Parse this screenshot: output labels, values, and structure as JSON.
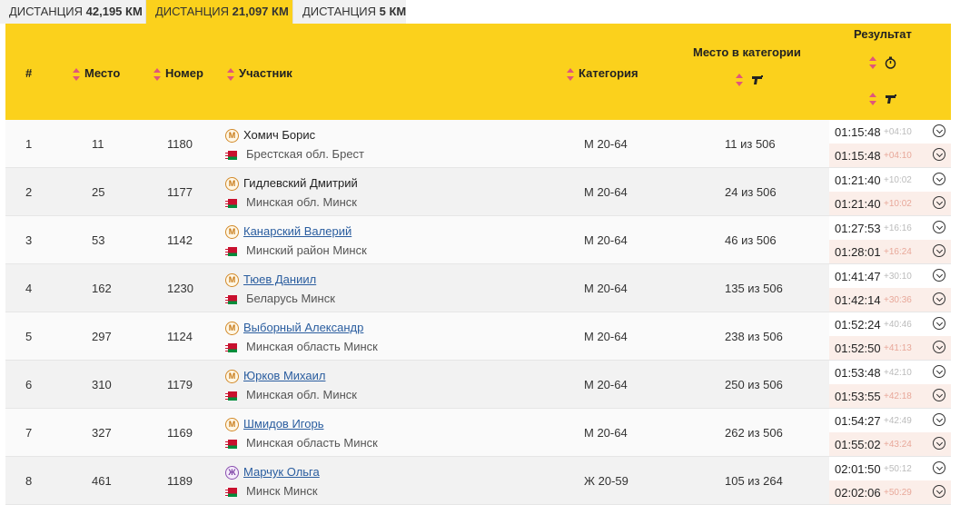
{
  "tabs": [
    {
      "prefix": "ДИСТАНЦИЯ ",
      "value": "42,195 КМ",
      "active": false
    },
    {
      "prefix": "ДИСТАНЦИЯ ",
      "value": "21,097 КМ",
      "active": true
    },
    {
      "prefix": "ДИСТАНЦИЯ ",
      "value": "5 КМ",
      "active": false
    }
  ],
  "header": {
    "index": "#",
    "place": "Место",
    "number": "Номер",
    "participant": "Участник",
    "category": "Категория",
    "place_in_category": "Место в категории",
    "result": "Результат"
  },
  "rows": [
    {
      "index": "1",
      "place": "11",
      "number": "1180",
      "gender": "М",
      "name": "Хомич Борис",
      "linked": false,
      "location": "Брестская обл. Брест",
      "category": "М 20-64",
      "cat_place": "11 из 506",
      "time1": "01:15:48",
      "gap1": "+04:10",
      "time2": "01:15:48",
      "gap2": "+04:10"
    },
    {
      "index": "2",
      "place": "25",
      "number": "1177",
      "gender": "М",
      "name": "Гидлевский Дмитрий",
      "linked": false,
      "location": "Минская обл. Минск",
      "category": "М 20-64",
      "cat_place": "24 из 506",
      "time1": "01:21:40",
      "gap1": "+10:02",
      "time2": "01:21:40",
      "gap2": "+10:02"
    },
    {
      "index": "3",
      "place": "53",
      "number": "1142",
      "gender": "М",
      "name": "Канарский Валерий",
      "linked": true,
      "location": "Минский район Минск",
      "category": "М 20-64",
      "cat_place": "46 из 506",
      "time1": "01:27:53",
      "gap1": "+16:16",
      "time2": "01:28:01",
      "gap2": "+16:24"
    },
    {
      "index": "4",
      "place": "162",
      "number": "1230",
      "gender": "М",
      "name": "Тюев Даниил",
      "linked": true,
      "location": "Беларусь Минск",
      "category": "М 20-64",
      "cat_place": "135 из 506",
      "time1": "01:41:47",
      "gap1": "+30:10",
      "time2": "01:42:14",
      "gap2": "+30:36"
    },
    {
      "index": "5",
      "place": "297",
      "number": "1124",
      "gender": "М",
      "name": "Выборный Александр",
      "linked": true,
      "location": "Минская область Минск",
      "category": "М 20-64",
      "cat_place": "238 из 506",
      "time1": "01:52:24",
      "gap1": "+40:46",
      "time2": "01:52:50",
      "gap2": "+41:13"
    },
    {
      "index": "6",
      "place": "310",
      "number": "1179",
      "gender": "М",
      "name": "Юрков Михаил",
      "linked": true,
      "location": "Минская обл. Минск",
      "category": "М 20-64",
      "cat_place": "250 из 506",
      "time1": "01:53:48",
      "gap1": "+42:10",
      "time2": "01:53:55",
      "gap2": "+42:18"
    },
    {
      "index": "7",
      "place": "327",
      "number": "1169",
      "gender": "М",
      "name": "Шмидов Игорь",
      "linked": true,
      "location": "Минская область Минск",
      "category": "М 20-64",
      "cat_place": "262 из 506",
      "time1": "01:54:27",
      "gap1": "+42:49",
      "time2": "01:55:02",
      "gap2": "+43:24"
    },
    {
      "index": "8",
      "place": "461",
      "number": "1189",
      "gender": "Ж",
      "name": "Марчук Ольга",
      "linked": true,
      "location": "Минск Минск",
      "category": "Ж 20-59",
      "cat_place": "105 из 264",
      "time1": "02:01:50",
      "gap1": "+50:12",
      "time2": "02:02:06",
      "gap2": "+50:29"
    }
  ]
}
